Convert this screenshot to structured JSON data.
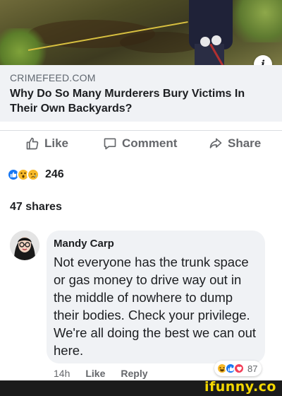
{
  "link_preview": {
    "domain": "CRIMEFEED.COM",
    "title": "Why Do So Many Murderers Bury Victims In Their Own Backyards?",
    "info_icon": "info-icon"
  },
  "actions": {
    "like_label": "Like",
    "comment_label": "Comment",
    "share_label": "Share"
  },
  "post_stats": {
    "reaction_types": [
      "like",
      "wow",
      "sad"
    ],
    "reaction_count": "246",
    "shares": "47 shares"
  },
  "comment": {
    "author": "Mandy Carp",
    "text": "Not everyone has the trunk space or gas money to drive way out in the middle of nowhere to dump their bodies. Check your privilege. We're all doing the best we can out here.",
    "time": "14h",
    "like_label": "Like",
    "reply_label": "Reply",
    "reaction_types": [
      "haha",
      "like",
      "love"
    ],
    "reaction_count": "87"
  },
  "watermark": "ifunny.co",
  "colors": {
    "like_blue": "#1877f2",
    "love_red": "#f33e58",
    "emoji_yellow": "#f7b928",
    "bubble_grey": "#f0f2f5",
    "watermark_yellow": "#f4d800"
  }
}
